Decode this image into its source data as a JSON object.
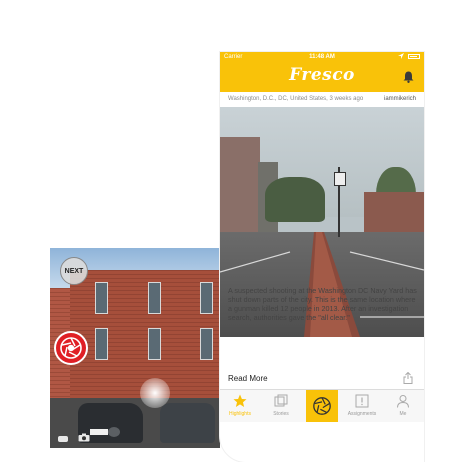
{
  "camera": {
    "next_label": "NEXT"
  },
  "status": {
    "carrier": "Carrier",
    "time": "11:48 AM"
  },
  "app": {
    "logo": "Fresco",
    "accent": "#f9c209",
    "shutter_color": "#e01f25"
  },
  "post": {
    "location": "Washington, D.C., DC, United States, 3 weeks ago",
    "user": "iammikerich",
    "page_dots": "• • •",
    "caption": "A suspected shooting at the Washington DC Navy Yard has shut down parts of the city. This is the same location where a gunman killed 12 people in 2013. After an investigation search, authorities gave the \"all clear.\"",
    "read_more": "Read More"
  },
  "tabs": [
    {
      "label": "Highlights",
      "icon": "star-icon",
      "active": true
    },
    {
      "label": "Stories",
      "icon": "stories-icon",
      "active": false
    },
    {
      "label": "",
      "icon": "camera-shutter-icon",
      "active": false
    },
    {
      "label": "Assignments",
      "icon": "assignments-icon",
      "active": false
    },
    {
      "label": "Me",
      "icon": "person-icon",
      "active": false
    }
  ]
}
